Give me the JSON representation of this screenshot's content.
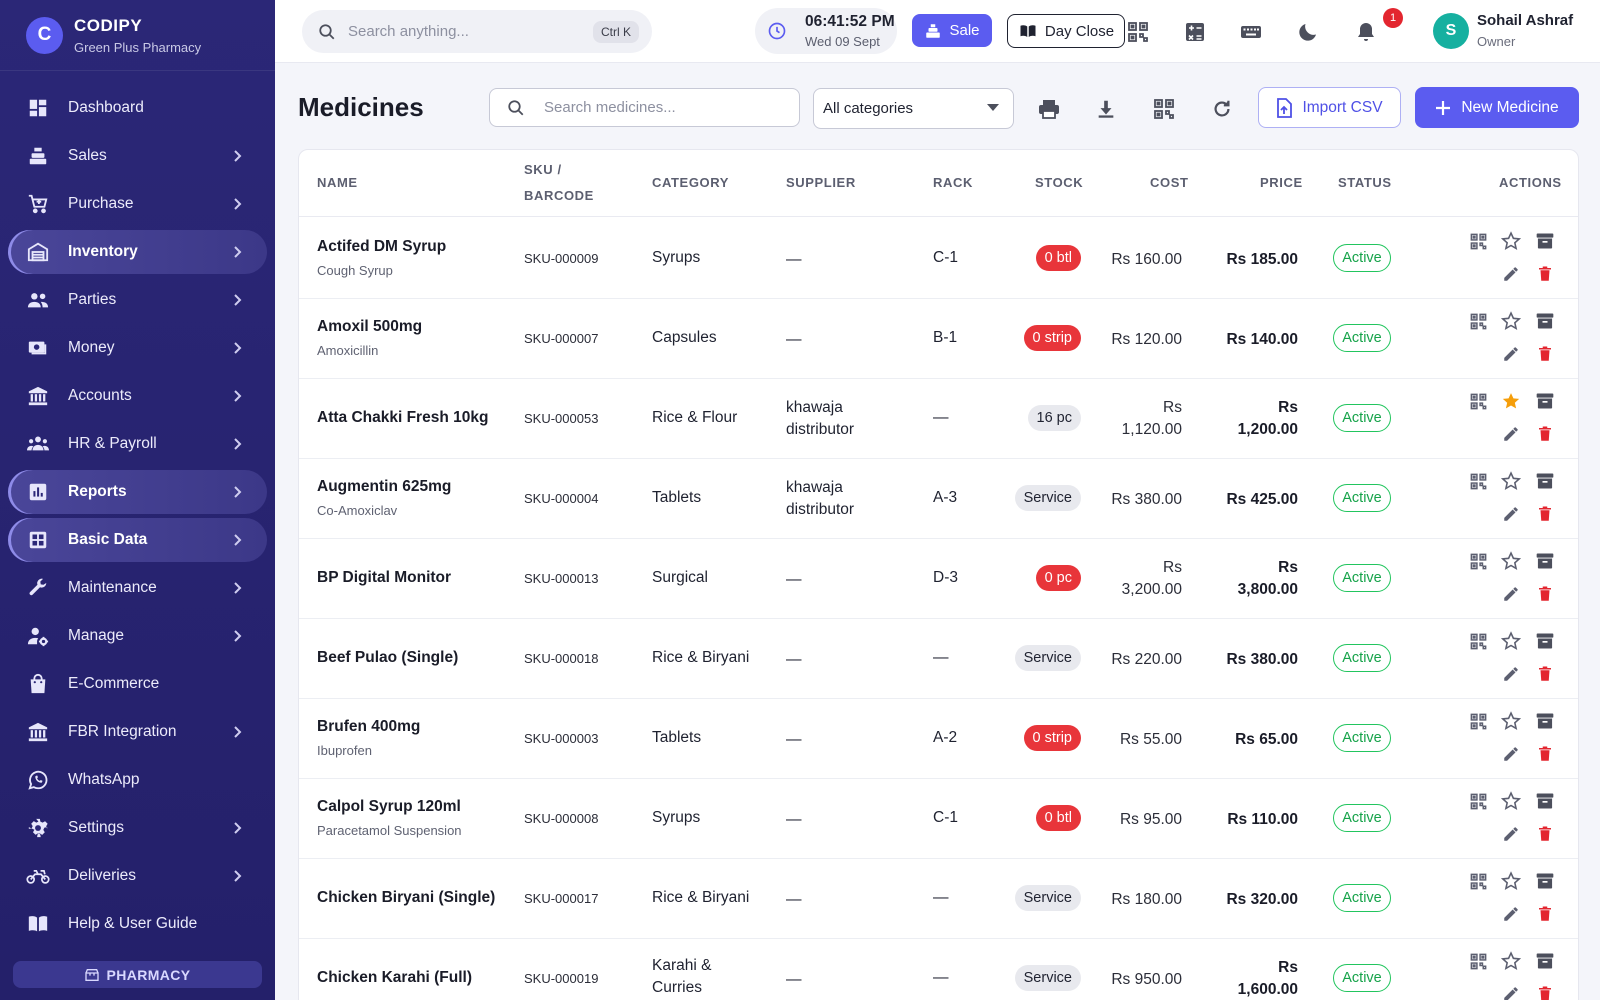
{
  "brand": {
    "logo_letter": "C",
    "name": "CODIPY",
    "subtitle": "Green Plus Pharmacy"
  },
  "sidebar": {
    "items": [
      {
        "label": "Dashboard",
        "icon": "dashboard-icon",
        "chevron": false,
        "active": false
      },
      {
        "label": "Sales",
        "icon": "cash-register-icon",
        "chevron": true,
        "active": false
      },
      {
        "label": "Purchase",
        "icon": "cart-icon",
        "chevron": true,
        "active": false
      },
      {
        "label": "Inventory",
        "icon": "warehouse-icon",
        "chevron": true,
        "active": true
      },
      {
        "label": "Parties",
        "icon": "people-icon",
        "chevron": true,
        "active": false
      },
      {
        "label": "Money",
        "icon": "money-icon",
        "chevron": true,
        "active": false
      },
      {
        "label": "Accounts",
        "icon": "bank-icon",
        "chevron": true,
        "active": false
      },
      {
        "label": "HR & Payroll",
        "icon": "group-icon",
        "chevron": true,
        "active": false
      },
      {
        "label": "Reports",
        "icon": "bar-chart-icon",
        "chevron": true,
        "active": true
      },
      {
        "label": "Basic Data",
        "icon": "grid-icon",
        "chevron": true,
        "active": true
      },
      {
        "label": "Maintenance",
        "icon": "wrench-icon",
        "chevron": true,
        "active": false
      },
      {
        "label": "Manage",
        "icon": "user-gear-icon",
        "chevron": true,
        "active": false
      },
      {
        "label": "E-Commerce",
        "icon": "shopping-bag-icon",
        "chevron": false,
        "active": false
      },
      {
        "label": "FBR Integration",
        "icon": "bank-icon",
        "chevron": true,
        "active": false
      },
      {
        "label": "WhatsApp",
        "icon": "whatsapp-icon",
        "chevron": false,
        "active": false
      },
      {
        "label": "Settings",
        "icon": "gear-icon",
        "chevron": true,
        "active": false
      },
      {
        "label": "Deliveries",
        "icon": "motorbike-icon",
        "chevron": true,
        "active": false
      },
      {
        "label": "Help & User Guide",
        "icon": "book-icon",
        "chevron": false,
        "active": false
      }
    ],
    "footer_label": "PHARMACY"
  },
  "topbar": {
    "search_placeholder": "Search anything...",
    "search_shortcut": "Ctrl K",
    "time": "06:41:52 PM",
    "date": "Wed 09 Sept",
    "sale_label": "Sale",
    "day_close_label": "Day Close",
    "notification_count": "1",
    "user": {
      "initial": "S",
      "name": "Sohail Ashraf",
      "role": "Owner"
    }
  },
  "page": {
    "title": "Medicines",
    "search_placeholder": "Search medicines...",
    "category_filter": "All categories",
    "import_label": "Import CSV",
    "new_label": "New Medicine"
  },
  "colors": {
    "accent": "#5b5cf0",
    "sidebar": "#2b2777",
    "danger": "#e3262f",
    "success": "#22c55e",
    "star": "#f59e0b"
  },
  "table": {
    "columns": {
      "name": "NAME",
      "sku_line1": "SKU /",
      "sku_line2": "BARCODE",
      "category": "CATEGORY",
      "supplier": "SUPPLIER",
      "rack": "RACK",
      "stock": "STOCK",
      "cost": "COST",
      "price": "PRICE",
      "status": "STATUS",
      "actions": "ACTIONS"
    },
    "rows": [
      {
        "name": "Actifed DM Syrup",
        "generic": "Cough Syrup",
        "sku": "SKU-000009",
        "category": "Syrups",
        "category2": "",
        "supplier": "—",
        "supplier2": "",
        "rack": "C-1",
        "stock": "0 btl",
        "stock_kind": "out",
        "cost": "Rs 160.00",
        "cost2": "",
        "price": "Rs 185.00",
        "price2": "",
        "status": "Active",
        "starred": false
      },
      {
        "name": "Amoxil 500mg",
        "generic": "Amoxicillin",
        "sku": "SKU-000007",
        "category": "Capsules",
        "category2": "",
        "supplier": "—",
        "supplier2": "",
        "rack": "B-1",
        "stock": "0 strip",
        "stock_kind": "out",
        "cost": "Rs 120.00",
        "cost2": "",
        "price": "Rs 140.00",
        "price2": "",
        "status": "Active",
        "starred": false
      },
      {
        "name": "Atta Chakki Fresh 10kg",
        "generic": "",
        "sku": "SKU-000053",
        "category": "Rice & Flour",
        "category2": "",
        "supplier": "khawaja",
        "supplier2": "distributor",
        "rack": "—",
        "stock": "16 pc",
        "stock_kind": "in",
        "cost": "Rs",
        "cost2": "1,120.00",
        "price": "Rs",
        "price2": "1,200.00",
        "status": "Active",
        "starred": true
      },
      {
        "name": "Augmentin 625mg",
        "generic": "Co-Amoxiclav",
        "sku": "SKU-000004",
        "category": "Tablets",
        "category2": "",
        "supplier": "khawaja",
        "supplier2": "distributor",
        "rack": "A-3",
        "stock": "Service",
        "stock_kind": "in",
        "cost": "Rs 380.00",
        "cost2": "",
        "price": "Rs 425.00",
        "price2": "",
        "status": "Active",
        "starred": false
      },
      {
        "name": "BP Digital Monitor",
        "generic": "",
        "sku": "SKU-000013",
        "category": "Surgical",
        "category2": "",
        "supplier": "—",
        "supplier2": "",
        "rack": "D-3",
        "stock": "0 pc",
        "stock_kind": "out",
        "cost": "Rs",
        "cost2": "3,200.00",
        "price": "Rs",
        "price2": "3,800.00",
        "status": "Active",
        "starred": false
      },
      {
        "name": "Beef Pulao (Single)",
        "generic": "",
        "sku": "SKU-000018",
        "category": "Rice & Biryani",
        "category2": "",
        "supplier": "—",
        "supplier2": "",
        "rack": "—",
        "stock": "Service",
        "stock_kind": "in",
        "cost": "Rs 220.00",
        "cost2": "",
        "price": "Rs 380.00",
        "price2": "",
        "status": "Active",
        "starred": false
      },
      {
        "name": "Brufen 400mg",
        "generic": "Ibuprofen",
        "sku": "SKU-000003",
        "category": "Tablets",
        "category2": "",
        "supplier": "—",
        "supplier2": "",
        "rack": "A-2",
        "stock": "0 strip",
        "stock_kind": "out",
        "cost": "Rs 55.00",
        "cost2": "",
        "price": "Rs 65.00",
        "price2": "",
        "status": "Active",
        "starred": false
      },
      {
        "name": "Calpol Syrup 120ml",
        "generic": "Paracetamol Suspension",
        "sku": "SKU-000008",
        "category": "Syrups",
        "category2": "",
        "supplier": "—",
        "supplier2": "",
        "rack": "C-1",
        "stock": "0 btl",
        "stock_kind": "out",
        "cost": "Rs 95.00",
        "cost2": "",
        "price": "Rs 110.00",
        "price2": "",
        "status": "Active",
        "starred": false
      },
      {
        "name": "Chicken Biryani (Single)",
        "generic": "",
        "sku": "SKU-000017",
        "category": "Rice & Biryani",
        "category2": "",
        "supplier": "—",
        "supplier2": "",
        "rack": "—",
        "stock": "Service",
        "stock_kind": "in",
        "cost": "Rs 180.00",
        "cost2": "",
        "price": "Rs 320.00",
        "price2": "",
        "status": "Active",
        "starred": false
      },
      {
        "name": "Chicken Karahi (Full)",
        "generic": "",
        "sku": "SKU-000019",
        "category": "Karahi &",
        "category2": "Curries",
        "supplier": "—",
        "supplier2": "",
        "rack": "—",
        "stock": "Service",
        "stock_kind": "in",
        "cost": "Rs 950.00",
        "cost2": "",
        "price": "Rs",
        "price2": "1,600.00",
        "status": "Active",
        "starred": false
      }
    ]
  }
}
